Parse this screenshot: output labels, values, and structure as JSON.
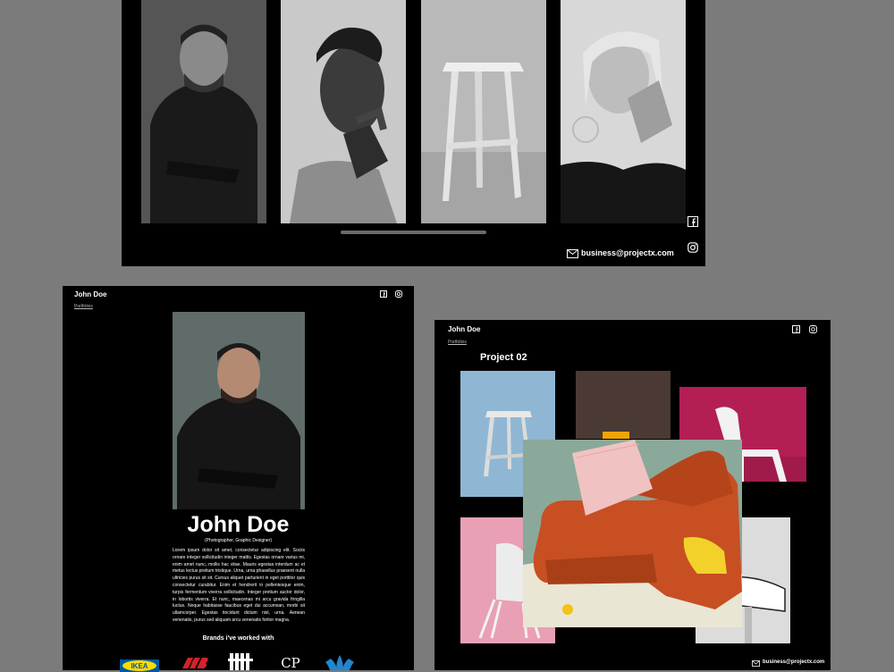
{
  "top_panel": {
    "email": "business@projectx.com",
    "images": [
      {
        "name": "bw portrait man in hoodie"
      },
      {
        "name": "bw portrait woman looking up"
      },
      {
        "name": "bw wooden stool"
      },
      {
        "name": "bw portrait woman with bangs"
      }
    ]
  },
  "profile_panel": {
    "brand": "John Doe",
    "nav_link": "Portfolios",
    "name": "John Doe",
    "role": "(Photographer, Graphic Designer)",
    "bio": "Lorem ipsum dolor sit amet, consectetur adipiscing elit. Sociis ornare integer sollicitudin integer mattis. Egestas ornare varius mi, enim amet nunc, mollis hac vitae. Mauris egestas interdum ac et metus lectus pretium tristique. Urna, urna phasellus praesent nulla ultricies purus sit sit. Cursus aliquet parturient in eget porttitor quis consectetur curabitur. Enim et hendrerit in pellentesque enim, turpis fermentum viverra sollicitudin. Integer pretium auctor dolor, in lobortis viverra. Et nunc, maecenas mi arcu gravida fringilla luctus. Neque habitasse faucibus eget dui accumsan, morbi sit ullamcorper. Egestas tincidunt dictum nisl, urna. Aenean venenatis, purus sed aliquam arcu venenatis fortior magna.",
    "brands_heading": "Brands i've worked with",
    "brand_logos": [
      "IKEA",
      "New Balance",
      "Undefeated",
      "CP",
      "Adidas"
    ]
  },
  "project_panel": {
    "brand": "John Doe",
    "nav_link": "Portfolios",
    "project_title": "Project 02",
    "email": "business@projectx.com"
  },
  "colors": {
    "background": "#7b7b7b",
    "panel": "#000000",
    "sofa": "#c84f22",
    "pink": "#e9a0b4",
    "blue": "#8fb7d4"
  }
}
